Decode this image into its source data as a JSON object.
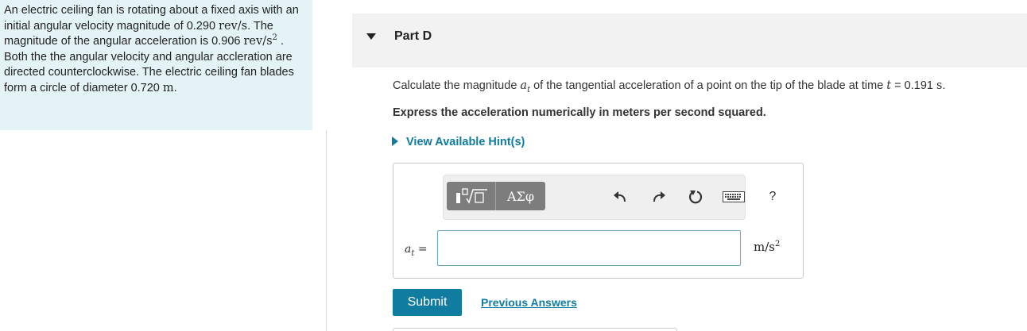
{
  "problem": {
    "t1": "An electric ceiling fan is rotating about a fixed axis with an initial angular velocity magnitude of ",
    "omega0": "0.290",
    "unit_rev_s": "rev/s",
    "t2": ". The magnitude of the angular acceleration is ",
    "alpha": "0.906",
    "unit_rev_s2_base": "rev/s",
    "unit_rev_s2_exp": "2",
    "t3": ". Both the the angular velocity and angular accleration are directed counterclockwise. The electric ceiling fan blades form a circle of diameter ",
    "diameter": "0.720",
    "unit_m": "m",
    "t4": "."
  },
  "part": {
    "title": "Part D",
    "caret_icon": "caret-down-icon"
  },
  "question": {
    "q1": "Calculate the magnitude ",
    "sym_base": "a",
    "sym_sub": "t",
    "q2": " of the tangential acceleration of a point on the tip of the blade at time ",
    "sym_time": "t",
    "q3": " = ",
    "time_value": "0.191",
    "time_unit": "s",
    "q4": "."
  },
  "instruction": "Express the acceleration numerically in meters per second squared.",
  "hint": {
    "label": "View Available Hint(s)"
  },
  "toolbar": {
    "symbols_label": "ΑΣφ",
    "help_label": "?",
    "icons": [
      "templates-icon",
      "undo-icon",
      "redo-icon",
      "reset-icon",
      "keyboard-icon",
      "help-icon"
    ]
  },
  "answer": {
    "var_base": "a",
    "var_sub": "t",
    "equals": "=",
    "value": "",
    "unit_base": "m/s",
    "unit_exp": "2"
  },
  "actions": {
    "submit_label": "Submit",
    "previous_label": "Previous Answers"
  },
  "colors": {
    "accent": "#0f7ca0",
    "problem_bg": "#e4f4f6",
    "header_bg": "#f2f2f2",
    "toolbar_btn": "#7d7d7d"
  }
}
